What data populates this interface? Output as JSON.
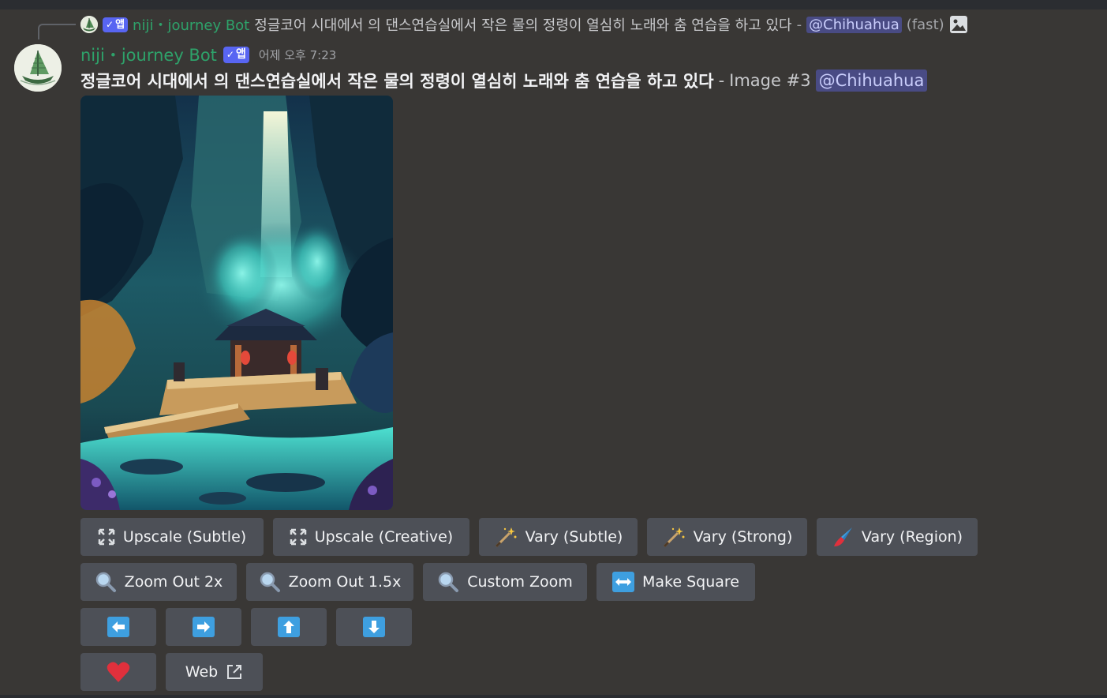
{
  "reply": {
    "bot_name": "niji",
    "bot_name_suffix": "journey Bot",
    "dot": "・",
    "badge_check": "✓",
    "badge_label": "앱",
    "prompt": "정글코어 시대에서 의 댄스연습실에서 작은 물의 정령이 열심히 노래와 춤 연습을 하고 있다",
    "dash": "-",
    "mention": "@Chihuahua",
    "speed": "(fast)",
    "attachment_icon": "image-icon"
  },
  "message": {
    "author": "niji",
    "author_suffix": "journey Bot",
    "dot": "・",
    "badge_check": "✓",
    "badge_label": "앱",
    "timestamp": "어제 오후 7:23",
    "prompt": "정글코어 시대에서 의 댄스연습실에서 작은 물의 정령이 열심히 노래와 춤 연습을 하고 있다",
    "dash": "-",
    "image_number": "Image #3",
    "mention": "@Chihuahua"
  },
  "buttons": {
    "row1": [
      {
        "label": "Upscale (Subtle)",
        "icon": "expand-icon"
      },
      {
        "label": "Upscale (Creative)",
        "icon": "expand-icon"
      },
      {
        "label": "Vary (Subtle)",
        "icon": "magic-wand-icon"
      },
      {
        "label": "Vary (Strong)",
        "icon": "magic-wand-icon"
      },
      {
        "label": "Vary (Region)",
        "icon": "paintbrush-icon"
      }
    ],
    "row2": [
      {
        "label": "Zoom Out 2x",
        "icon": "magnifier-icon"
      },
      {
        "label": "Zoom Out 1.5x",
        "icon": "magnifier-icon"
      },
      {
        "label": "Custom Zoom",
        "icon": "magnifier-icon"
      },
      {
        "label": "Make Square",
        "icon": "left-right-arrow-icon"
      }
    ],
    "row3": [
      {
        "icon": "arrow-left-icon"
      },
      {
        "icon": "arrow-right-icon"
      },
      {
        "icon": "arrow-up-icon"
      },
      {
        "icon": "arrow-down-icon"
      }
    ],
    "row4": [
      {
        "icon": "heart-icon"
      },
      {
        "label": "Web",
        "icon": "external-link-icon"
      }
    ]
  },
  "colors": {
    "background": "#393735",
    "button": "#4d5057",
    "bot_name": "#2ea26a",
    "badge": "#5865f2",
    "mention_bg": "#494b84",
    "arrow_blue": "#3e9fe0",
    "heart": "#e0303c"
  }
}
